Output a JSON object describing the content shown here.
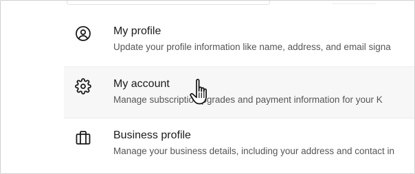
{
  "menu": {
    "items": [
      {
        "icon": "user-circle-icon",
        "title": "My profile",
        "description": "Update your profile information like name, address, and email signa"
      },
      {
        "icon": "gear-icon",
        "title": "My account",
        "description": "Manage subscriptio  upgrades and payment information for your K"
      },
      {
        "icon": "briefcase-icon",
        "title": "Business profile",
        "description": "Manage your business details, including your address and contact in"
      }
    ]
  },
  "colors": {
    "title_text": "#1a1a1a",
    "description_text": "#555555",
    "hover_background": "#f7f7f7",
    "divider": "#ececec"
  },
  "cursor": {
    "icon": "hand-pointer-icon"
  }
}
